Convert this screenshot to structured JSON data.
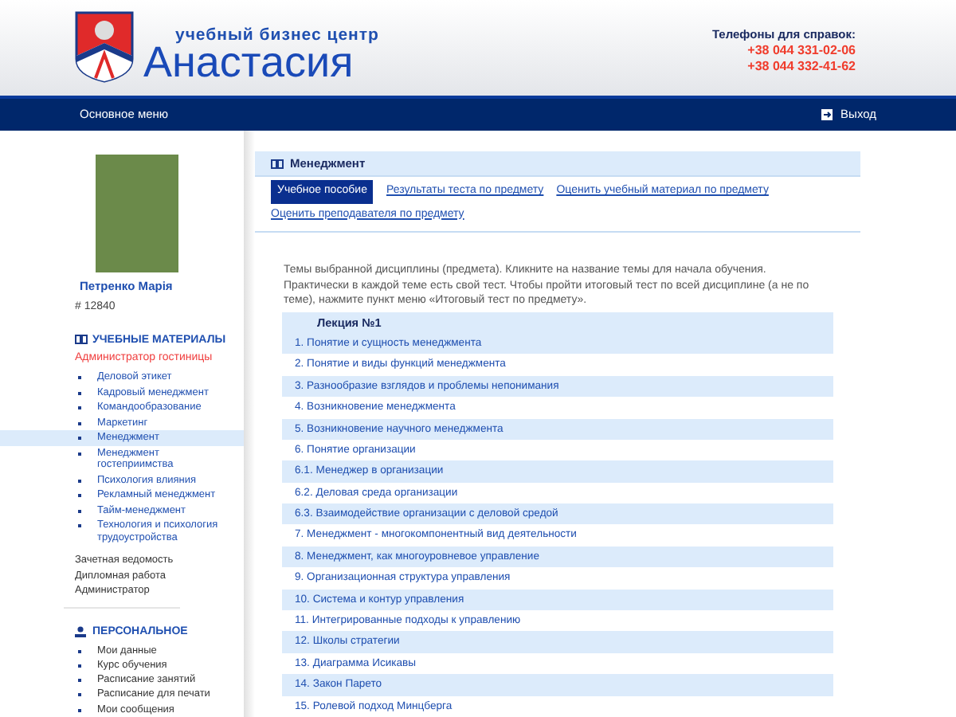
{
  "header": {
    "tagline": "учебный бизнес центр",
    "brand": "Анастасия",
    "phones_label": "Телефоны для справок:",
    "phones": [
      "+38 044 331-02-06",
      "+38 044 332-41-62"
    ]
  },
  "navbar": {
    "menu": "Основное меню",
    "logout": "Выход"
  },
  "profile": {
    "name": "Петренко Марія",
    "id": "# 12840"
  },
  "materials": {
    "title": "УЧЕБНЫЕ МАТЕРИАЛЫ",
    "course": "Администратор гостиницы",
    "items": [
      {
        "label": "Деловой этикет",
        "selected": false
      },
      {
        "label": "Кадровый менеджмент",
        "selected": false
      },
      {
        "label": "Командообразование",
        "selected": false
      },
      {
        "label": "Маркетинг",
        "selected": false
      },
      {
        "label": "Менеджмент",
        "selected": true
      },
      {
        "label": "Менеджмент гостеприимства",
        "selected": false
      },
      {
        "label": "Психология влияния",
        "selected": false
      },
      {
        "label": "Рекламный менеджмент",
        "selected": false
      },
      {
        "label": "Тайм-менеджмент",
        "selected": false
      },
      {
        "label": "Технология и психология трудоустройства",
        "selected": false
      }
    ],
    "links": [
      "Зачетная ведомость",
      "Дипломная работа",
      "Администратор"
    ]
  },
  "personal": {
    "title": "ПЕРСОНАЛЬНОЕ",
    "items": [
      "Мои данные",
      "Курс обучения",
      "Расписание занятий",
      "Расписание для печати",
      "Мои сообщения"
    ]
  },
  "content": {
    "title": "Менеджмент",
    "tabs": [
      {
        "label": "Учебное пособие",
        "selected": true
      },
      {
        "label": "Результаты теста по предмету",
        "selected": false
      },
      {
        "label": "Оценить учебный материал по предмету",
        "selected": false
      },
      {
        "label": "Оценить преподавателя по предмету",
        "selected": false
      }
    ],
    "intro": "Темы выбранной дисциплины (предмета). Кликните на название темы для начала обучения. Практически в каждой теме есть свой тест. Чтобы пройти итоговый тест по всей дисциплине (а не по теме), нажмите пункт меню «Итоговый тест по предмету».",
    "lecture": "Лекция №1",
    "topics": [
      "1. Понятие и сущность менеджмента",
      "2. Понятие и виды функций менеджмента",
      "3. Разнообразие взглядов и проблемы непонимания",
      "4. Возникновение менеджмента",
      "5. Возникновение научного менеджмента",
      "6. Понятие организации",
      "6.1. Менеджер в организации",
      "6.2. Деловая среда организации",
      "6.3. Взаимодействие организации с деловой средой",
      "7. Менеджмент - многокомпонентный вид деятельности",
      "8. Менеджмент, как многоуровневое управление",
      "9. Организационная структура управления",
      "10. Система и контур управления",
      "11. Интегрированные подходы к управлению",
      "12. Школы стратегии",
      "13. Диаграмма Исикавы",
      "14. Закон Парето",
      "15. Ролевой подход Минцберга"
    ]
  }
}
